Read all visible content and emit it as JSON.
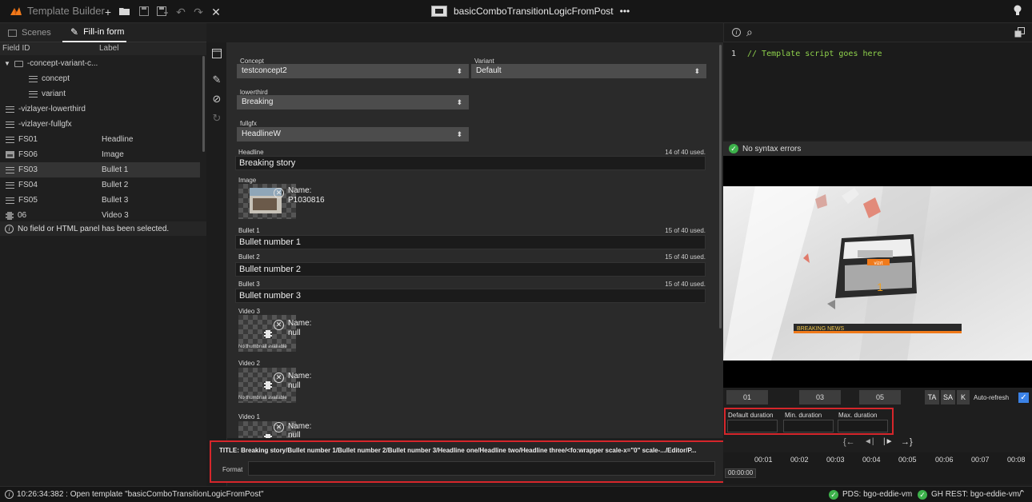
{
  "app": {
    "title": "Template Builder",
    "document": "basicComboTransitionLogicFromPost",
    "more": "•••"
  },
  "tabs": {
    "scenes": "Scenes",
    "fillin": "Fill-in form"
  },
  "fields": {
    "header": {
      "id": "Field ID",
      "label": "Label"
    },
    "rows": [
      {
        "id": "-concept-variant-c...",
        "label": "",
        "icon": "folder-icon"
      },
      {
        "id": "concept",
        "label": "",
        "icon": "text-field-icon"
      },
      {
        "id": "variant",
        "label": "",
        "icon": "text-field-icon"
      },
      {
        "id": "-vizlayer-lowerthird",
        "label": "",
        "icon": "text-field-icon"
      },
      {
        "id": "-vizlayer-fullgfx",
        "label": "",
        "icon": "text-field-icon"
      },
      {
        "id": "FS01",
        "label": "Headline",
        "icon": "text-field-icon"
      },
      {
        "id": "FS06",
        "label": "Image",
        "icon": "image-field-icon"
      },
      {
        "id": "FS03",
        "label": "Bullet 1",
        "icon": "text-field-icon"
      },
      {
        "id": "FS04",
        "label": "Bullet 2",
        "icon": "text-field-icon"
      },
      {
        "id": "FS05",
        "label": "Bullet 3",
        "icon": "text-field-icon"
      },
      {
        "id": "06",
        "label": "Video 3",
        "icon": "video-field-icon"
      }
    ],
    "no_selection": "No field or HTML panel has been selected."
  },
  "form": {
    "concept": {
      "label": "Concept",
      "value": "testconcept2"
    },
    "variant": {
      "label": "Variant",
      "value": "Default"
    },
    "lowerthird": {
      "label": "lowerthird",
      "value": "Breaking"
    },
    "fullgfx": {
      "label": "fullgfx",
      "value": "HeadlineW"
    },
    "headline": {
      "label": "Headline",
      "value": "Breaking story",
      "count": "14 of 40 used."
    },
    "image": {
      "label": "Image",
      "name_label": "Name:",
      "name": "P1030816"
    },
    "bullet1": {
      "label": "Bullet 1",
      "value": "Bullet number 1",
      "count": "15 of 40 used."
    },
    "bullet2": {
      "label": "Bullet 2",
      "value": "Bullet number 2",
      "count": "15 of 40 used."
    },
    "bullet3": {
      "label": "Bullet 3",
      "value": "Bullet number 3",
      "count": "15 of 40 used."
    },
    "video3": {
      "label": "Video 3",
      "name_label": "Name:",
      "name": "null",
      "no_thumb": "No thumbnail available"
    },
    "video2": {
      "label": "Video 2",
      "name_label": "Name:",
      "name": "null",
      "no_thumb": "No thumbnail available"
    },
    "video1": {
      "label": "Video 1",
      "name_label": "Name:",
      "name": "null"
    },
    "title_line": "TITLE: Breaking story/Bullet number 1/Bullet number 2/Bullet number 3/Headline one/Headline two/Headline three/<fo:wrapper scale-x=\"0\" scale-.../Editor/P...",
    "format_label": "Format"
  },
  "script": {
    "line": "1",
    "text": "// Template script goes here",
    "status": "No syntax errors"
  },
  "preview": {
    "banner": "BREAKING NEWS",
    "card_text": "vizrt",
    "card_number": "1"
  },
  "timeline": {
    "markers": [
      "01",
      "03",
      "05"
    ],
    "toggles": [
      "TA",
      "SA",
      "K"
    ],
    "autorefresh": "Auto-refresh",
    "durations": {
      "default": "Default duration",
      "min": "Min. duration",
      "max": "Max. duration"
    },
    "controls": [
      "{←",
      "◄|",
      "|►",
      "→}"
    ],
    "ticks": [
      "00:01",
      "00:02",
      "00:03",
      "00:04",
      "00:05",
      "00:06",
      "00:07",
      "00:08"
    ],
    "current": "00:00:00"
  },
  "status": {
    "message": "10:26:34:382 : Open template \"basicComboTransitionLogicFromPost\"",
    "pds": "PDS: bgo-eddie-vm",
    "ghrest": "GH REST: bgo-eddie-vm/"
  },
  "colors": {
    "accent_red": "#d6262b",
    "ok_green": "#3db24b",
    "comment_green": "#8fd24c",
    "orange": "#f07a1a"
  }
}
